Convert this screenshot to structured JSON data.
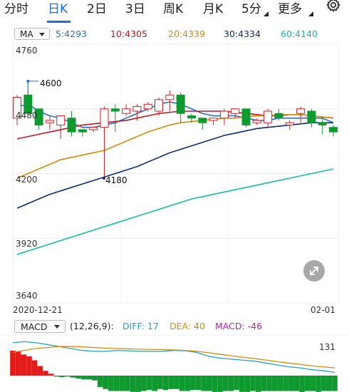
{
  "tabs": {
    "items": [
      {
        "key": "fenshi",
        "label": "分时",
        "active": false
      },
      {
        "key": "rik",
        "label": "日K",
        "active": true
      },
      {
        "key": "2day",
        "label": "2日",
        "active": false
      },
      {
        "key": "3day",
        "label": "3日",
        "active": false
      },
      {
        "key": "zhouk",
        "label": "周K",
        "active": false
      },
      {
        "key": "yuek",
        "label": "月K",
        "active": false
      },
      {
        "key": "5min",
        "label": "5分",
        "active": false
      },
      {
        "key": "more",
        "label": "更多",
        "active": false
      }
    ],
    "settings_icon": "gear-icon"
  },
  "ma_legend": {
    "button_label": "MA",
    "items": [
      {
        "label": "5:4293",
        "color": "#1f6fd6"
      },
      {
        "label": "10:4305",
        "color": "#c4171e"
      },
      {
        "label": "20:4339",
        "color": "#d8890a"
      },
      {
        "label": "30:4334",
        "color": "#0b2a85"
      },
      {
        "label": "60:4140",
        "color": "#12bfa0"
      }
    ]
  },
  "price_axis": {
    "ticks": [
      "4760",
      "4200",
      "3920",
      "3640"
    ],
    "partial_tick": "4480"
  },
  "date_axis": {
    "start": "2020-12-21",
    "end": "02-01"
  },
  "annotations": {
    "high": "4600",
    "low": "4180"
  },
  "macd_legend": {
    "button_label": "MACD",
    "params": "(12,26,9):",
    "items": [
      {
        "label": "DIFF: 17",
        "color": "#1fa2c4"
      },
      {
        "label": "DEA: 40",
        "color": "#d8890a"
      },
      {
        "label": "MACD: -46",
        "color": "#b31fb8"
      }
    ],
    "axis_value": "131"
  },
  "colors": {
    "up": "#e41b1b",
    "down": "#0f9a2f",
    "accent": "#1f6fd6"
  },
  "chart_data": {
    "type": "candlestick",
    "ylim": [
      3640,
      4760
    ],
    "candles": [
      {
        "o": 4440,
        "h": 4540,
        "l": 4410,
        "c": 4530
      },
      {
        "o": 4540,
        "h": 4600,
        "l": 4460,
        "c": 4460
      },
      {
        "o": 4480,
        "h": 4480,
        "l": 4390,
        "c": 4410
      },
      {
        "o": 4420,
        "h": 4450,
        "l": 4390,
        "c": 4430
      },
      {
        "o": 4410,
        "h": 4450,
        "l": 4350,
        "c": 4450
      },
      {
        "o": 4440,
        "h": 4470,
        "l": 4360,
        "c": 4380
      },
      {
        "o": 4390,
        "h": 4390,
        "l": 4360,
        "c": 4380
      },
      {
        "o": 4390,
        "h": 4400,
        "l": 4380,
        "c": 4400
      },
      {
        "o": 4400,
        "h": 4490,
        "l": 4180,
        "c": 4480
      },
      {
        "o": 4480,
        "h": 4500,
        "l": 4380,
        "c": 4470
      },
      {
        "o": 4460,
        "h": 4500,
        "l": 4450,
        "c": 4480
      },
      {
        "o": 4470,
        "h": 4500,
        "l": 4430,
        "c": 4490
      },
      {
        "o": 4480,
        "h": 4510,
        "l": 4470,
        "c": 4500
      },
      {
        "o": 4470,
        "h": 4530,
        "l": 4450,
        "c": 4520
      },
      {
        "o": 4520,
        "h": 4560,
        "l": 4470,
        "c": 4540
      },
      {
        "o": 4540,
        "h": 4550,
        "l": 4420,
        "c": 4460
      },
      {
        "o": 4450,
        "h": 4460,
        "l": 4420,
        "c": 4440
      },
      {
        "o": 4440,
        "h": 4440,
        "l": 4390,
        "c": 4420
      },
      {
        "o": 4430,
        "h": 4440,
        "l": 4410,
        "c": 4440
      },
      {
        "o": 4440,
        "h": 4480,
        "l": 4410,
        "c": 4470
      },
      {
        "o": 4460,
        "h": 4480,
        "l": 4440,
        "c": 4480
      },
      {
        "o": 4480,
        "h": 4480,
        "l": 4400,
        "c": 4410
      },
      {
        "o": 4420,
        "h": 4440,
        "l": 4410,
        "c": 4430
      },
      {
        "o": 4420,
        "h": 4480,
        "l": 4400,
        "c": 4470
      },
      {
        "o": 4460,
        "h": 4480,
        "l": 4430,
        "c": 4440
      },
      {
        "o": 4410,
        "h": 4430,
        "l": 4390,
        "c": 4420
      },
      {
        "o": 4460,
        "h": 4490,
        "l": 4420,
        "c": 4480
      },
      {
        "o": 4470,
        "h": 4480,
        "l": 4400,
        "c": 4420
      },
      {
        "o": 4420,
        "h": 4440,
        "l": 4370,
        "c": 4410
      },
      {
        "o": 4400,
        "h": 4410,
        "l": 4360,
        "c": 4380
      }
    ],
    "ma": [
      {
        "name": "MA5",
        "color": "#1f6fd6",
        "values": [
          4490,
          4500,
          4470,
          4450,
          4440,
          4420,
          4400,
          4400,
          4410,
          4420,
          4440,
          4460,
          4480,
          4500,
          4510,
          4500,
          4480,
          4460,
          4450,
          4450,
          4450,
          4440,
          4430,
          4430,
          4440,
          4440,
          4440,
          4440,
          4440,
          4420
        ]
      },
      {
        "name": "MA10",
        "color": "#c4171e",
        "values": [
          4350,
          4360,
          4370,
          4380,
          4390,
          4400,
          4410,
          4415,
          4420,
          4425,
          4430,
          4440,
          4450,
          4460,
          4465,
          4470,
          4470,
          4470,
          4470,
          4470,
          4465,
          4460,
          4455,
          4450,
          4450,
          4455,
          4455,
          4450,
          4445,
          4440
        ]
      },
      {
        "name": "MA20",
        "color": "#d8890a",
        "values": [
          4180,
          4200,
          4220,
          4240,
          4260,
          4270,
          4280,
          4290,
          4300,
          4320,
          4340,
          4360,
          4380,
          4395,
          4410,
          4420,
          4425,
          4430,
          4435,
          4440,
          4440,
          4445,
          4450,
          4450,
          4455,
          4455,
          4455,
          4450,
          4445,
          4440
        ]
      },
      {
        "name": "MA30",
        "color": "#0b2a85",
        "values": [
          4050,
          4070,
          4090,
          4110,
          4125,
          4140,
          4155,
          4170,
          4185,
          4200,
          4215,
          4230,
          4250,
          4270,
          4290,
          4305,
          4320,
          4335,
          4350,
          4365,
          4375,
          4385,
          4395,
          4400,
          4405,
          4410,
          4415,
          4420,
          4420,
          4420
        ]
      },
      {
        "name": "MA60",
        "color": "#12bfa0",
        "values": [
          3850,
          3865,
          3880,
          3895,
          3910,
          3925,
          3940,
          3955,
          3970,
          3985,
          4000,
          4015,
          4030,
          4045,
          4060,
          4075,
          4090,
          4100,
          4110,
          4120,
          4130,
          4140,
          4150,
          4160,
          4170,
          4180,
          4190,
          4200,
          4210,
          4220
        ]
      }
    ],
    "macd_hist": [
      130,
      125,
      110,
      100,
      80,
      50,
      25,
      10,
      -5,
      -8,
      -5,
      -10,
      -15,
      -20,
      -20,
      -25,
      -60,
      -70,
      -80,
      -80,
      -80,
      -80,
      -85,
      -85,
      -80,
      -75,
      -80,
      -70,
      -75,
      -70,
      -70,
      -80,
      -80,
      -75,
      -75,
      -80,
      -80,
      -85,
      -85,
      -80,
      -80,
      -75,
      -85,
      -85,
      -80,
      -85,
      -80,
      -80,
      -80,
      -80,
      -80,
      -80,
      -80,
      -85,
      -80,
      -80,
      -85,
      -80,
      -80,
      -80
    ],
    "diff": [
      170,
      175,
      170,
      160,
      150,
      140,
      130,
      125,
      125,
      130,
      128,
      125,
      125,
      125,
      130,
      128,
      120,
      100,
      90,
      85,
      80,
      75,
      65,
      55,
      45,
      40,
      30,
      25,
      17
    ],
    "dea": [
      120,
      130,
      140,
      145,
      150,
      150,
      148,
      145,
      142,
      140,
      138,
      136,
      135,
      134,
      132,
      130,
      125,
      118,
      110,
      102,
      95,
      88,
      80,
      72,
      65,
      58,
      50,
      45,
      40
    ]
  }
}
